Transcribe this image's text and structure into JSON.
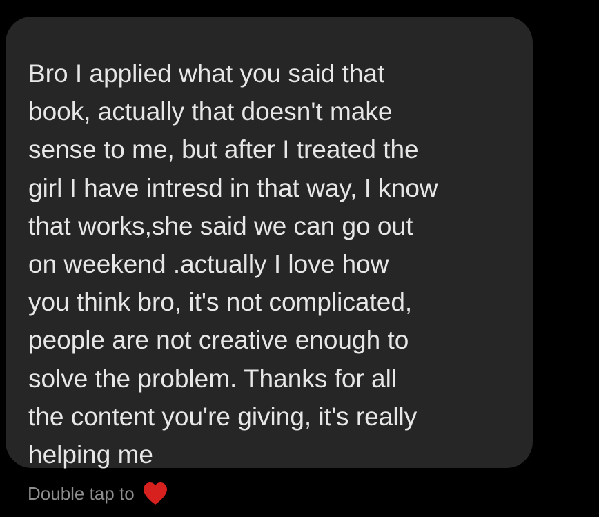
{
  "message": {
    "text": "Bro I applied what you said that\nbook, actually that doesn't make\nsense to me, but after I treated the\ngirl I have intresd in that way, I know\nthat works,she said we can go out\non weekend .actually I love how\nyou think bro, it's not complicated,\npeople are not creative enough to\nsolve the problem. Thanks for all\nthe content you're giving, it's really\nhelping me"
  },
  "reaction_hint": {
    "label": "Double tap to",
    "icon": "heart-icon"
  },
  "colors": {
    "background": "#000000",
    "bubble": "#262626",
    "message_text": "#e7e7e7",
    "hint_text": "#8e8e8e",
    "heart": "#d6211f"
  }
}
